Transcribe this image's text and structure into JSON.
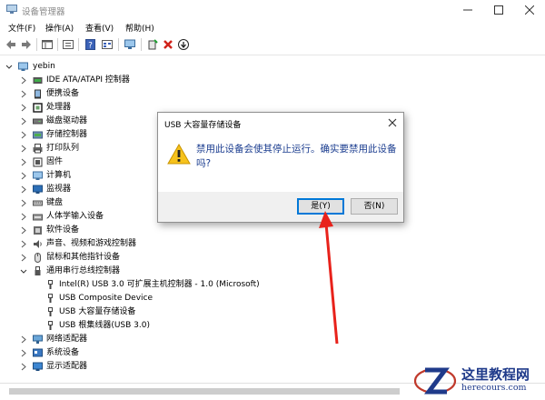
{
  "window": {
    "title": "设备管理器"
  },
  "menu": [
    {
      "label": "文件(F)"
    },
    {
      "label": "操作(A)"
    },
    {
      "label": "查看(V)"
    },
    {
      "label": "帮助(H)"
    }
  ],
  "toolbar": {
    "icons": [
      "back-icon",
      "forward-icon",
      "properties-panel-icon",
      "list-icon",
      "help-icon",
      "view-icon",
      "monitor-icon",
      "add-driver-icon",
      "remove-icon",
      "download-icon"
    ]
  },
  "tree": {
    "root": "yebin",
    "categories": [
      {
        "label": "IDE ATA/ATAPI 控制器",
        "icon": "ide-icon"
      },
      {
        "label": "便携设备",
        "icon": "portable-icon"
      },
      {
        "label": "处理器",
        "icon": "cpu-icon"
      },
      {
        "label": "磁盘驱动器",
        "icon": "disk-icon"
      },
      {
        "label": "存储控制器",
        "icon": "storage-icon"
      },
      {
        "label": "打印队列",
        "icon": "printer-icon"
      },
      {
        "label": "固件",
        "icon": "firmware-icon"
      },
      {
        "label": "计算机",
        "icon": "computer-icon"
      },
      {
        "label": "监视器",
        "icon": "monitor-icon"
      },
      {
        "label": "键盘",
        "icon": "keyboard-icon"
      },
      {
        "label": "人体学输入设备",
        "icon": "hid-icon"
      },
      {
        "label": "软件设备",
        "icon": "software-icon"
      },
      {
        "label": "声音、视频和游戏控制器",
        "icon": "sound-icon"
      },
      {
        "label": "鼠标和其他指针设备",
        "icon": "mouse-icon"
      },
      {
        "label": "通用串行总线控制器",
        "icon": "usb-icon"
      }
    ],
    "usb_children": [
      {
        "label": "Intel(R) USB 3.0 可扩展主机控制器 - 1.0 (Microsoft)"
      },
      {
        "label": "USB Composite Device"
      },
      {
        "label": "USB 大容量存储设备"
      },
      {
        "label": "USB 根集线器(USB 3.0)"
      }
    ],
    "after": [
      {
        "label": "网络适配器",
        "icon": "network-icon"
      },
      {
        "label": "系统设备",
        "icon": "system-icon"
      },
      {
        "label": "显示适配器",
        "icon": "display-icon"
      }
    ]
  },
  "dialog": {
    "title": "USB 大容量存储设备",
    "message": "禁用此设备会使其停止运行。确实要禁用此设备吗?",
    "yes_label": "是(Y)",
    "no_label": "否(N)"
  },
  "watermark": {
    "title": "这里教程网",
    "url": "herecours.com"
  },
  "colors": {
    "accent": "#0078d7",
    "arrow": "#e8221b",
    "message": "#1a3c8f"
  }
}
